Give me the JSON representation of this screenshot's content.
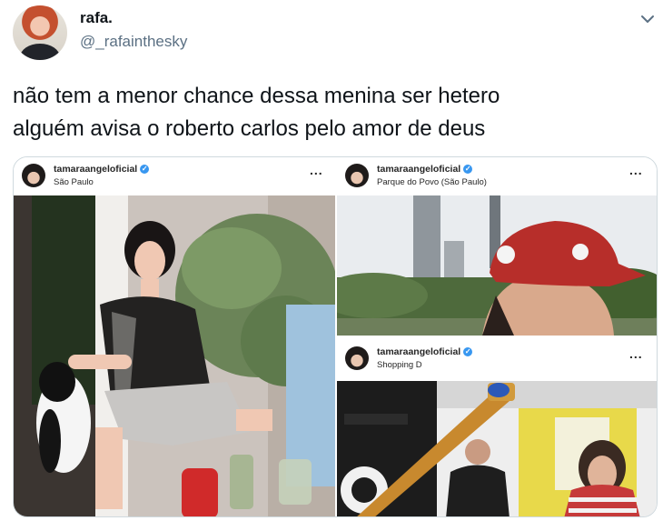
{
  "tweet": {
    "display_name": "rafa.",
    "handle": "@_rafainthesky",
    "text_lines": [
      "não tem a menor chance dessa menina ser hetero",
      "alguém avisa o roberto carlos pelo amor de deus"
    ],
    "menu_icon": "chevron-down-icon"
  },
  "posts": [
    {
      "username": "tamaraangeloficial",
      "location": "São Paulo",
      "more": "..."
    },
    {
      "username": "tamaraangeloficial",
      "location": "Parque do Povo (São Paulo)",
      "more": "..."
    },
    {
      "username": "tamaraangeloficial",
      "location": "Shopping D",
      "more": "..."
    }
  ],
  "colors": {
    "text": "#0f1419",
    "secondary": "#5b7083",
    "border": "#cfd9de",
    "verified": "#3897f0"
  }
}
